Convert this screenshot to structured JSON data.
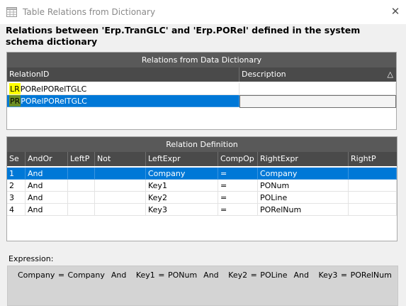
{
  "window": {
    "title": "Table Relations from Dictionary",
    "close_icon": "close-icon"
  },
  "heading": "Relations between 'Erp.TranGLC' and 'Erp.PORel' defined in the system schema dictionary",
  "relations_grid": {
    "title": "Relations from Data Dictionary",
    "columns": [
      "RelationID",
      "Description"
    ],
    "sort_indicator": "△",
    "rows": [
      {
        "prefix": "LR",
        "rest": "PORelPORelTGLC",
        "description": "",
        "selected": false
      },
      {
        "prefix": "PR",
        "rest": "PORelPORelTGLC",
        "description": "",
        "selected": true
      }
    ]
  },
  "definition_grid": {
    "title": "Relation Definition",
    "columns": [
      "Se",
      "AndOr",
      "LeftP",
      "Not",
      "LeftExpr",
      "CompOp",
      "RightExpr",
      "RightP"
    ],
    "rows": [
      {
        "seq": "1",
        "andor": "And",
        "leftp": "",
        "not": "",
        "leftexpr": "Company",
        "compop": "=",
        "rightexpr": "Company",
        "rightp": "",
        "selected": true
      },
      {
        "seq": "2",
        "andor": "And",
        "leftp": "",
        "not": "",
        "leftexpr": "Key1",
        "compop": "=",
        "rightexpr": "PONum",
        "rightp": "",
        "selected": false
      },
      {
        "seq": "3",
        "andor": "And",
        "leftp": "",
        "not": "",
        "leftexpr": "Key2",
        "compop": "=",
        "rightexpr": "POLine",
        "rightp": "",
        "selected": false
      },
      {
        "seq": "4",
        "andor": "And",
        "leftp": "",
        "not": "",
        "leftexpr": "Key3",
        "compop": "=",
        "rightexpr": "PORelNum",
        "rightp": "",
        "selected": false
      }
    ]
  },
  "expression": {
    "label": "Expression:",
    "text": "Company = Company  And   Key1 = PONum  And   Key2 = POLine  And   Key3 = PORelNum"
  },
  "colors": {
    "selection": "#0078d7",
    "header_bg": "#4a4a4a",
    "group_title_bg": "#595959",
    "prefix_yellow": "#ffff00",
    "prefix_green": "#6b8e23"
  }
}
